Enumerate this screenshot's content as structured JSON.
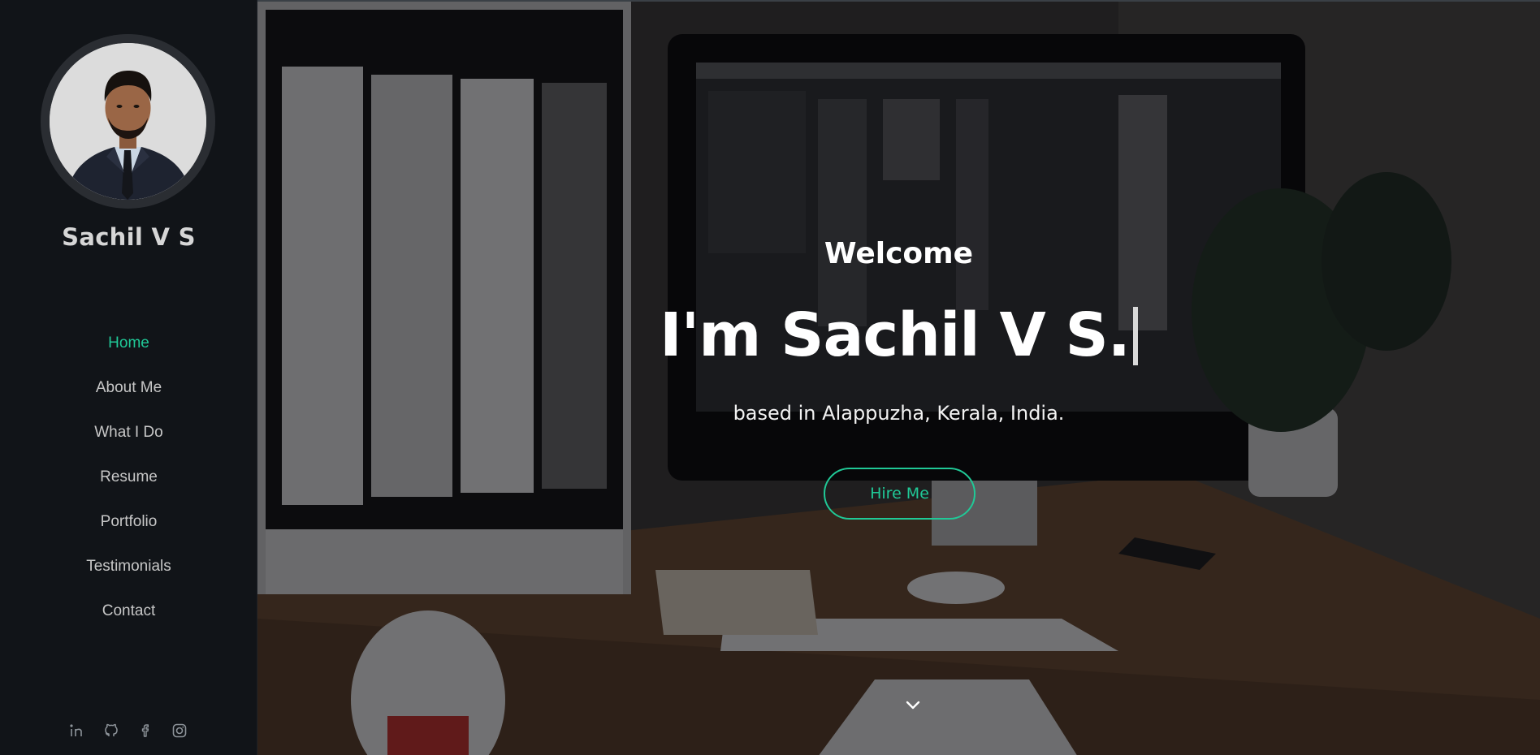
{
  "sidebar": {
    "name": "Sachil V S",
    "nav": [
      {
        "label": "Home",
        "active": true
      },
      {
        "label": "About Me",
        "active": false
      },
      {
        "label": "What I Do",
        "active": false
      },
      {
        "label": "Resume",
        "active": false
      },
      {
        "label": "Portfolio",
        "active": false
      },
      {
        "label": "Testimonials",
        "active": false
      },
      {
        "label": "Contact",
        "active": false
      }
    ],
    "socials": [
      "linkedin-icon",
      "github-icon",
      "facebook-icon",
      "instagram-icon"
    ]
  },
  "hero": {
    "welcome": "Welcome",
    "headline": "I'm Sachil V S.",
    "subline": "based in Alappuzha, Kerala, India.",
    "cta_label": "Hire Me",
    "scroll_icon": "chevron-down-icon"
  },
  "colors": {
    "accent": "#20c997",
    "sidebar_bg": "#111418",
    "text_light": "#ffffff"
  }
}
